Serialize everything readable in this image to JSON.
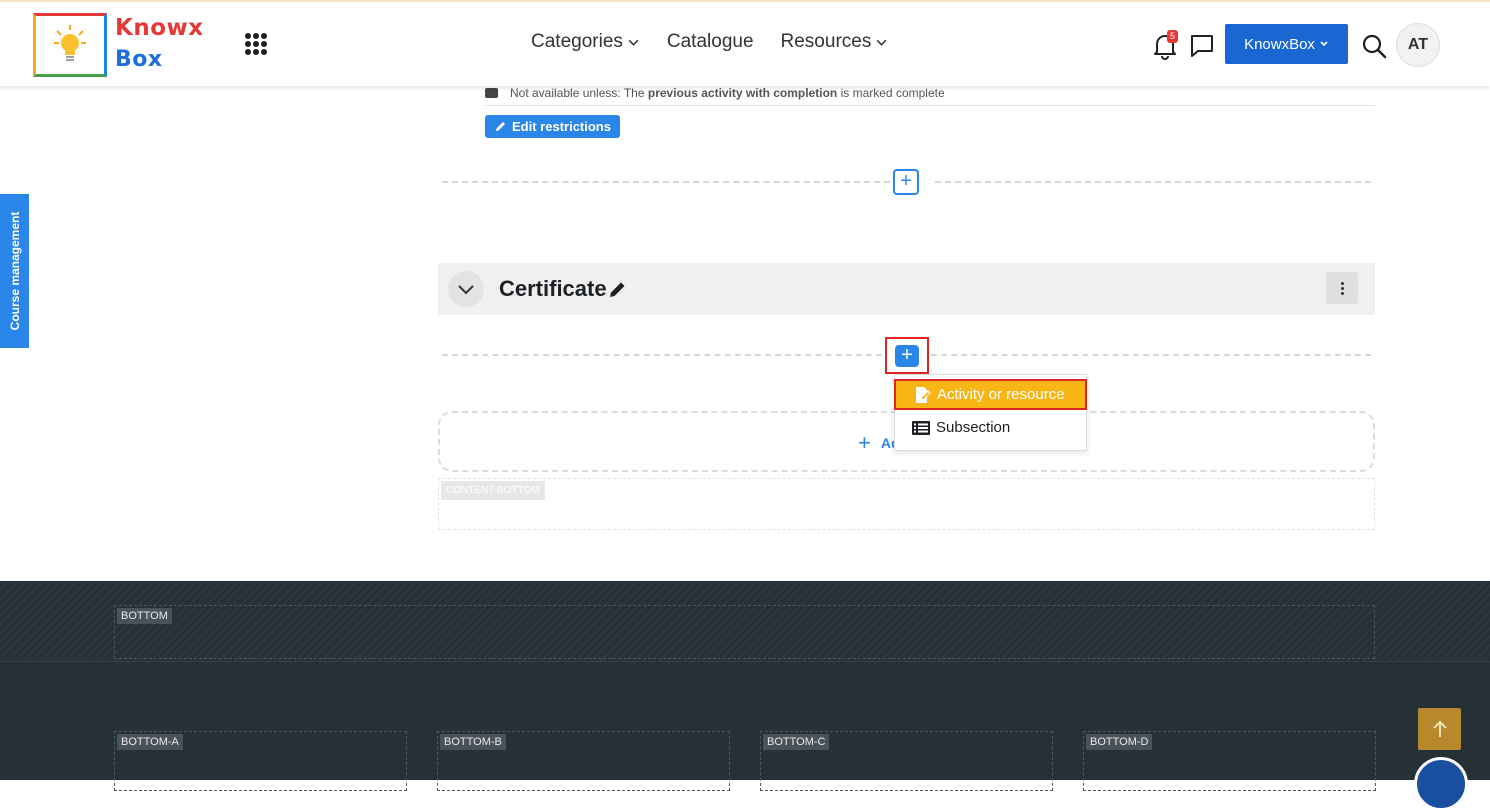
{
  "header": {
    "logo_line1": "Knowx",
    "logo_line2": "Box",
    "nav": [
      {
        "label": "Categories",
        "has_chevron": true
      },
      {
        "label": "Catalogue",
        "has_chevron": false
      },
      {
        "label": "Resources",
        "has_chevron": true
      }
    ],
    "notification_count": "5",
    "org_button": "KnowxBox",
    "avatar_initials": "AT"
  },
  "sidebar": {
    "course_management_tab": "Course management"
  },
  "main": {
    "restriction_note": {
      "prefix": "Not available unless: The",
      "bold": "previous activity with completion",
      "suffix": "is marked complete"
    },
    "edit_restrictions_label": "Edit restrictions",
    "section": {
      "title": "Certificate"
    },
    "add_menu": {
      "items": [
        {
          "label": "Activity or resource",
          "icon": "file-edit-icon",
          "highlighted": true
        },
        {
          "label": "Subsection",
          "icon": "list-icon",
          "highlighted": false
        }
      ]
    },
    "add_section_label": "Ad",
    "content_bottom_tag": "CONTENT-BOTTOM"
  },
  "footer": {
    "bottom_tag": "BOTTOM",
    "columns": [
      "BOTTOM-A",
      "BOTTOM-B",
      "BOTTOM-C",
      "BOTTOM-D"
    ]
  },
  "colors": {
    "primary": "#2a86e8",
    "button": "#1a66d2",
    "highlight": "#f7b516",
    "footer_bg": "#263037",
    "to_top": "#b8892c"
  }
}
